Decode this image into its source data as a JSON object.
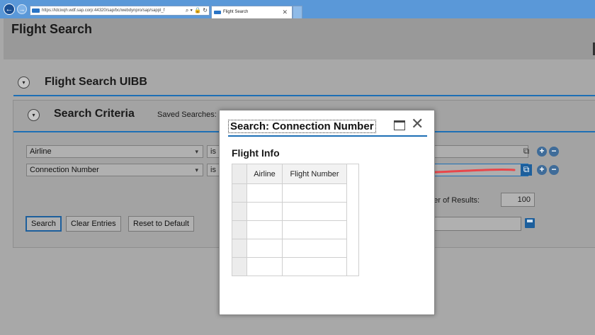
{
  "browser": {
    "url": "https://ldcixqh.wdf.sap.corp:44320/sap/bc/webdynpro/sap/sappl_f",
    "tab_title": "Flight Search",
    "tab_close": "✕",
    "address_icons": "⌕ ▾ 🔒 ↻"
  },
  "page": {
    "title": "Flight Search",
    "uibb_title": "Flight Search UIBB",
    "criteria_title": "Search Criteria",
    "saved_searches": "Saved Searches:",
    "rows": [
      {
        "field": "Airline",
        "operator": "is"
      },
      {
        "field": "Connection Number",
        "operator": "is"
      }
    ],
    "result_label": "mber of Results:",
    "result_value": "100",
    "buttons": {
      "search": "Search",
      "clear": "Clear Entries",
      "reset": "Reset to Default"
    }
  },
  "dialog": {
    "title": "Search: Connection Number",
    "section_title": "Flight Info",
    "columns": [
      "Airline",
      "Flight Number"
    ],
    "rows": [
      [
        "",
        ""
      ],
      [
        "",
        ""
      ],
      [
        "",
        ""
      ],
      [
        "",
        ""
      ],
      [
        "",
        ""
      ]
    ]
  },
  "colors": {
    "accent": "#1d6fb5",
    "annotation_arrow": "#e8464a"
  }
}
